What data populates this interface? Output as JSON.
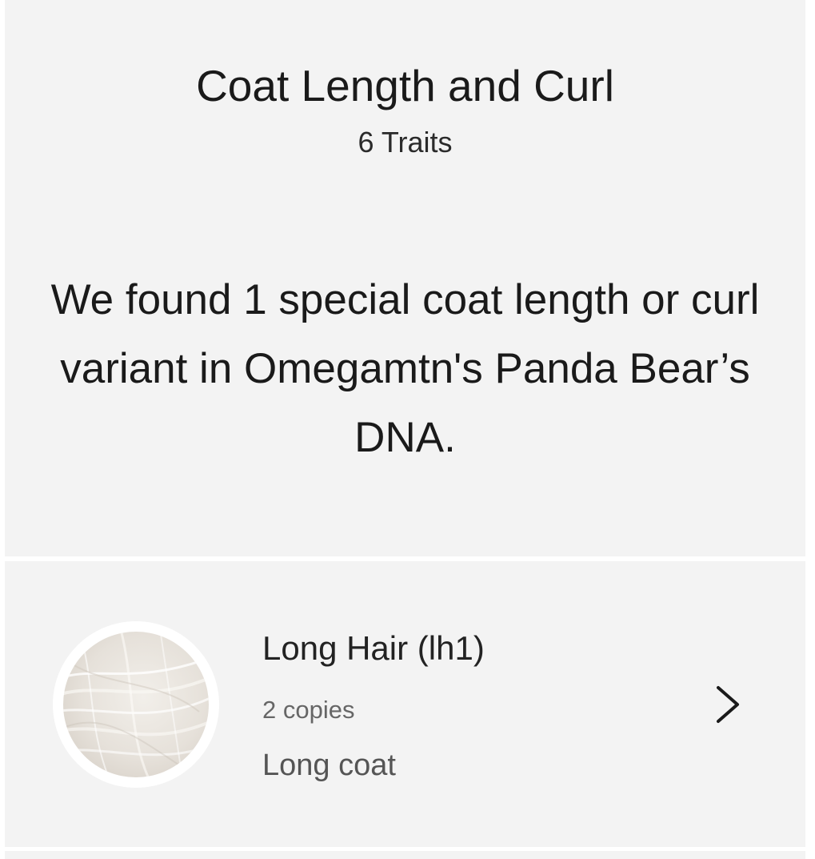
{
  "header": {
    "title": "Coat Length and Curl",
    "trait_count": "6 Traits",
    "summary": "We found 1 special coat length or curl variant in Omegamtn's Panda Bear’s DNA."
  },
  "traits": [
    {
      "name": "Long Hair (lh1)",
      "copies": "2 copies",
      "description": "Long coat",
      "image": "white-long-fur-thumbnail",
      "action_icon": "chevron-right-icon"
    }
  ],
  "colors": {
    "card_background": "#f3f3f3",
    "page_background": "#ffffff",
    "primary_text": "#1a1a1a",
    "secondary_text": "#666666"
  }
}
